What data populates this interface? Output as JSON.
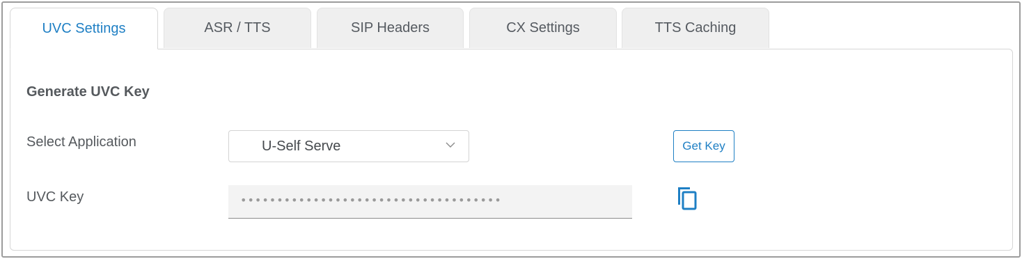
{
  "tabs": [
    {
      "label": "UVC Settings",
      "active": true
    },
    {
      "label": "ASR / TTS",
      "active": false
    },
    {
      "label": "SIP Headers",
      "active": false
    },
    {
      "label": "CX Settings",
      "active": false
    },
    {
      "label": "TTS Caching",
      "active": false
    }
  ],
  "panel": {
    "section_title": "Generate UVC Key",
    "select_application_label": "Select Application",
    "select_application_value": "U-Self Serve",
    "get_key_button": "Get Key",
    "uvc_key_label": "UVC Key",
    "uvc_key_value": "••••••••••••••••••••••••••••••••••••",
    "copy_icon": "copy-icon"
  },
  "colors": {
    "accent": "#1e7fc4",
    "tab_inactive_bg": "#efefef",
    "text": "#55595d",
    "frame_border": "#9c9c9c"
  }
}
